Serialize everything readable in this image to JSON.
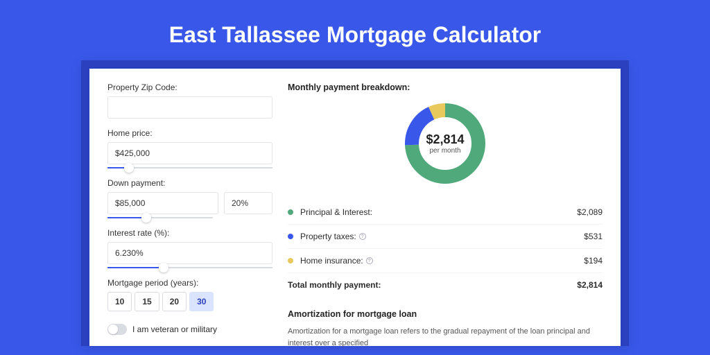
{
  "title": "East Tallassee Mortgage Calculator",
  "form": {
    "zip_label": "Property Zip Code:",
    "zip_value": "",
    "home_price_label": "Home price:",
    "home_price_value": "$425,000",
    "down_payment_label": "Down payment:",
    "down_payment_value": "$85,000",
    "down_payment_pct": "20%",
    "interest_label": "Interest rate (%):",
    "interest_value": "6.230%",
    "period_label": "Mortgage period (years):",
    "periods": [
      "10",
      "15",
      "20",
      "30"
    ],
    "period_active_index": 3,
    "veteran_label": "I am veteran or military"
  },
  "breakdown": {
    "title": "Monthly payment breakdown:",
    "center_amount": "$2,814",
    "center_sub": "per month",
    "rows": [
      {
        "color": "#4fa97a",
        "label": "Principal & Interest:",
        "value": "$2,089",
        "info": false
      },
      {
        "color": "#3958ea",
        "label": "Property taxes:",
        "value": "$531",
        "info": true
      },
      {
        "color": "#e9c95b",
        "label": "Home insurance:",
        "value": "$194",
        "info": true
      }
    ],
    "total_label": "Total monthly payment:",
    "total_value": "$2,814"
  },
  "amortization": {
    "title": "Amortization for mortgage loan",
    "body": "Amortization for a mortgage loan refers to the gradual repayment of the loan principal and interest over a specified"
  },
  "chart_data": {
    "type": "pie",
    "title": "Monthly payment breakdown",
    "series": [
      {
        "name": "Principal & Interest",
        "value": 2089,
        "color": "#4fa97a"
      },
      {
        "name": "Property taxes",
        "value": 531,
        "color": "#3958ea"
      },
      {
        "name": "Home insurance",
        "value": 194,
        "color": "#e9c95b"
      }
    ],
    "total": 2814,
    "center_label": "$2,814 per month"
  }
}
